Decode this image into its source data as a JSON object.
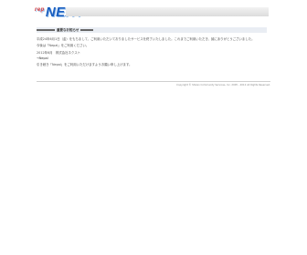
{
  "header": {
    "logo_prefix": "rep",
    "logo_text": "NEXT"
  },
  "notice": {
    "title": "重要なお知らせ",
    "paragraph1": "平成24年6月1日（金）をもちまして、ご利用いただいておりましたサービスを終了いたしました。これまでご利用いただき、誠にありがとうございました。",
    "paragraph2": "今後は「Nepal」をご利用ください。",
    "paragraph3": "2012年6月　株式会社ネクスト",
    "link_label": "→Nepal",
    "paragraph4": "引き続き「Nepal」をご利用いただけますようお願い申し上げます。"
  },
  "footer": {
    "copyright": "Copyright © Shizen Community Services, Inc. 2005 - 2012 All Rights Reserved."
  }
}
